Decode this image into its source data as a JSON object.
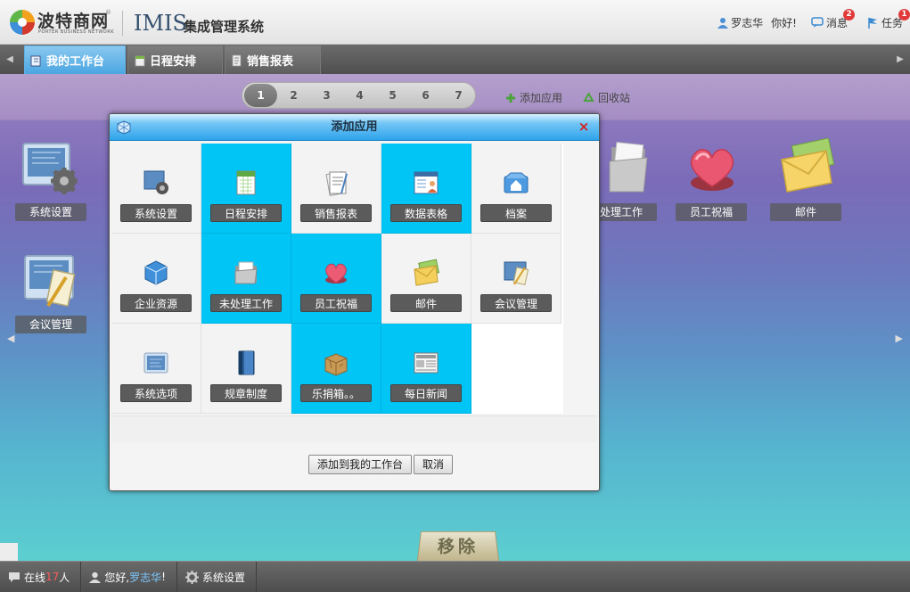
{
  "header": {
    "brand": "波特商网",
    "brand_sub": "PORTER BUSINESS NETWORK",
    "brand_reg": "®",
    "product": "IMIS",
    "system_name": "集成管理系统",
    "user_name": "罗志华",
    "greeting": "你好!",
    "messages_label": "消息",
    "messages_count": "2",
    "tasks_label": "任务",
    "tasks_count": "1"
  },
  "tabs": [
    {
      "label": "我的工作台",
      "active": true
    },
    {
      "label": "日程安排",
      "active": false
    },
    {
      "label": "销售报表",
      "active": false
    }
  ],
  "desktop": {
    "pages": [
      "1",
      "2",
      "3",
      "4",
      "5",
      "6",
      "7"
    ],
    "current_page": "1",
    "add_app_label": "添加应用",
    "recycle_label": "回收站",
    "apps": [
      {
        "label": "系统设置",
        "icon": "settings-gear-icon"
      },
      {
        "label": "会议管理",
        "icon": "meeting-icon"
      },
      {
        "label": "处理工作",
        "icon": "folder-icon"
      },
      {
        "label": "员工祝福",
        "icon": "heart-gift-icon"
      },
      {
        "label": "邮件",
        "icon": "mail-icon"
      }
    ],
    "remove_label": "移除"
  },
  "dialog": {
    "title": "添加应用",
    "close_symbol": "×",
    "items": [
      {
        "label": "系统设置",
        "icon": "settings-icon",
        "selected": false
      },
      {
        "label": "日程安排",
        "icon": "calendar-sheet-icon",
        "selected": true
      },
      {
        "label": "销售报表",
        "icon": "report-icon",
        "selected": false
      },
      {
        "label": "数据表格",
        "icon": "data-table-icon",
        "selected": true
      },
      {
        "label": "档案",
        "icon": "archive-icon",
        "selected": false
      },
      {
        "label": "企业资源",
        "icon": "resource-cube-icon",
        "selected": false
      },
      {
        "label": "未处理工作",
        "icon": "folder-icon",
        "selected": true
      },
      {
        "label": "员工祝福",
        "icon": "heart-icon",
        "selected": true
      },
      {
        "label": "邮件",
        "icon": "mail-icon",
        "selected": false
      },
      {
        "label": "会议管理",
        "icon": "meeting-icon",
        "selected": false
      },
      {
        "label": "系统选项",
        "icon": "options-icon",
        "selected": false
      },
      {
        "label": "规章制度",
        "icon": "book-icon",
        "selected": false
      },
      {
        "label": "乐捐箱。。",
        "icon": "donation-box-icon",
        "selected": true
      },
      {
        "label": "每日新闻",
        "icon": "newspaper-icon",
        "selected": true
      }
    ],
    "add_button": "添加到我的工作台",
    "cancel_button": "取消"
  },
  "footer": {
    "online_prefix": "在线",
    "online_count": "17",
    "online_suffix": "人",
    "hello_prefix": "您好,",
    "hello_user": "罗志华",
    "hello_suffix": "!",
    "settings_label": "系统设置"
  },
  "colors": {
    "selected_cell": "#00c5f5",
    "titlebar": "#2ea3eb",
    "badge": "#e03a3a"
  }
}
